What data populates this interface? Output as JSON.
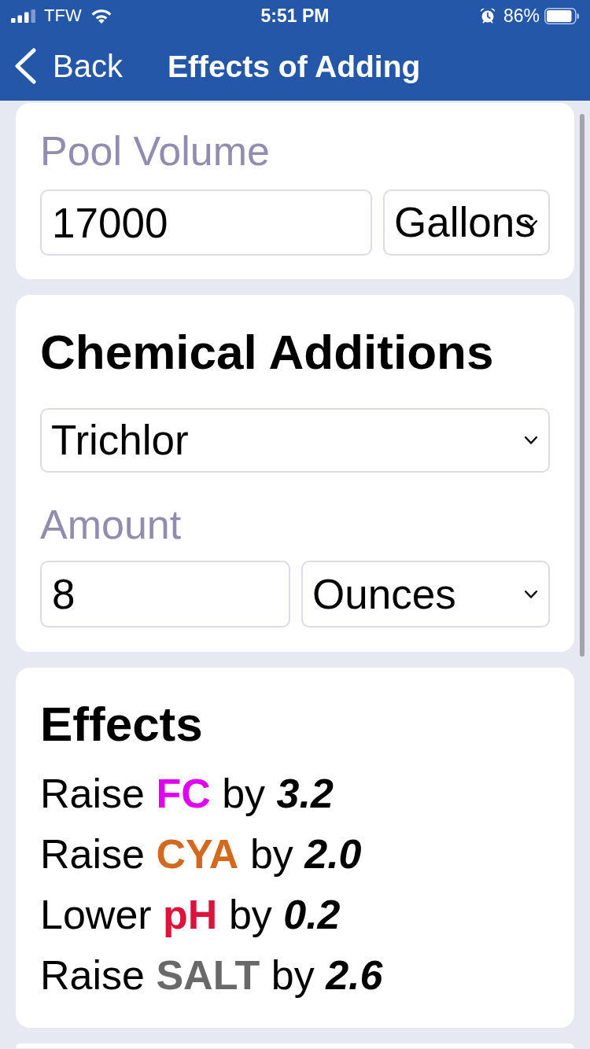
{
  "status_bar": {
    "carrier": "TFW",
    "time": "5:51 PM",
    "battery": "86%"
  },
  "nav": {
    "back": "Back",
    "title": "Effects of Adding"
  },
  "pool_volume": {
    "label": "Pool Volume",
    "value": "17000",
    "unit": "Gallons"
  },
  "chemical_additions": {
    "title": "Chemical Additions",
    "chemical": "Trichlor",
    "amount_label": "Amount",
    "amount_value": "8",
    "amount_unit": "Ounces"
  },
  "effects": {
    "title": "Effects",
    "items": [
      {
        "verb": "Raise",
        "parameter": "FC",
        "color": "#e100f0",
        "preposition": "by",
        "amount": "3.2"
      },
      {
        "verb": "Raise",
        "parameter": "CYA",
        "color": "#d2691e",
        "preposition": "by",
        "amount": "2.0"
      },
      {
        "verb": "Lower",
        "parameter": "pH",
        "color": "#dc143c",
        "preposition": "by",
        "amount": "0.2"
      },
      {
        "verb": "Raise",
        "parameter": "SALT",
        "color": "#696969",
        "preposition": "by",
        "amount": "2.6"
      }
    ]
  }
}
